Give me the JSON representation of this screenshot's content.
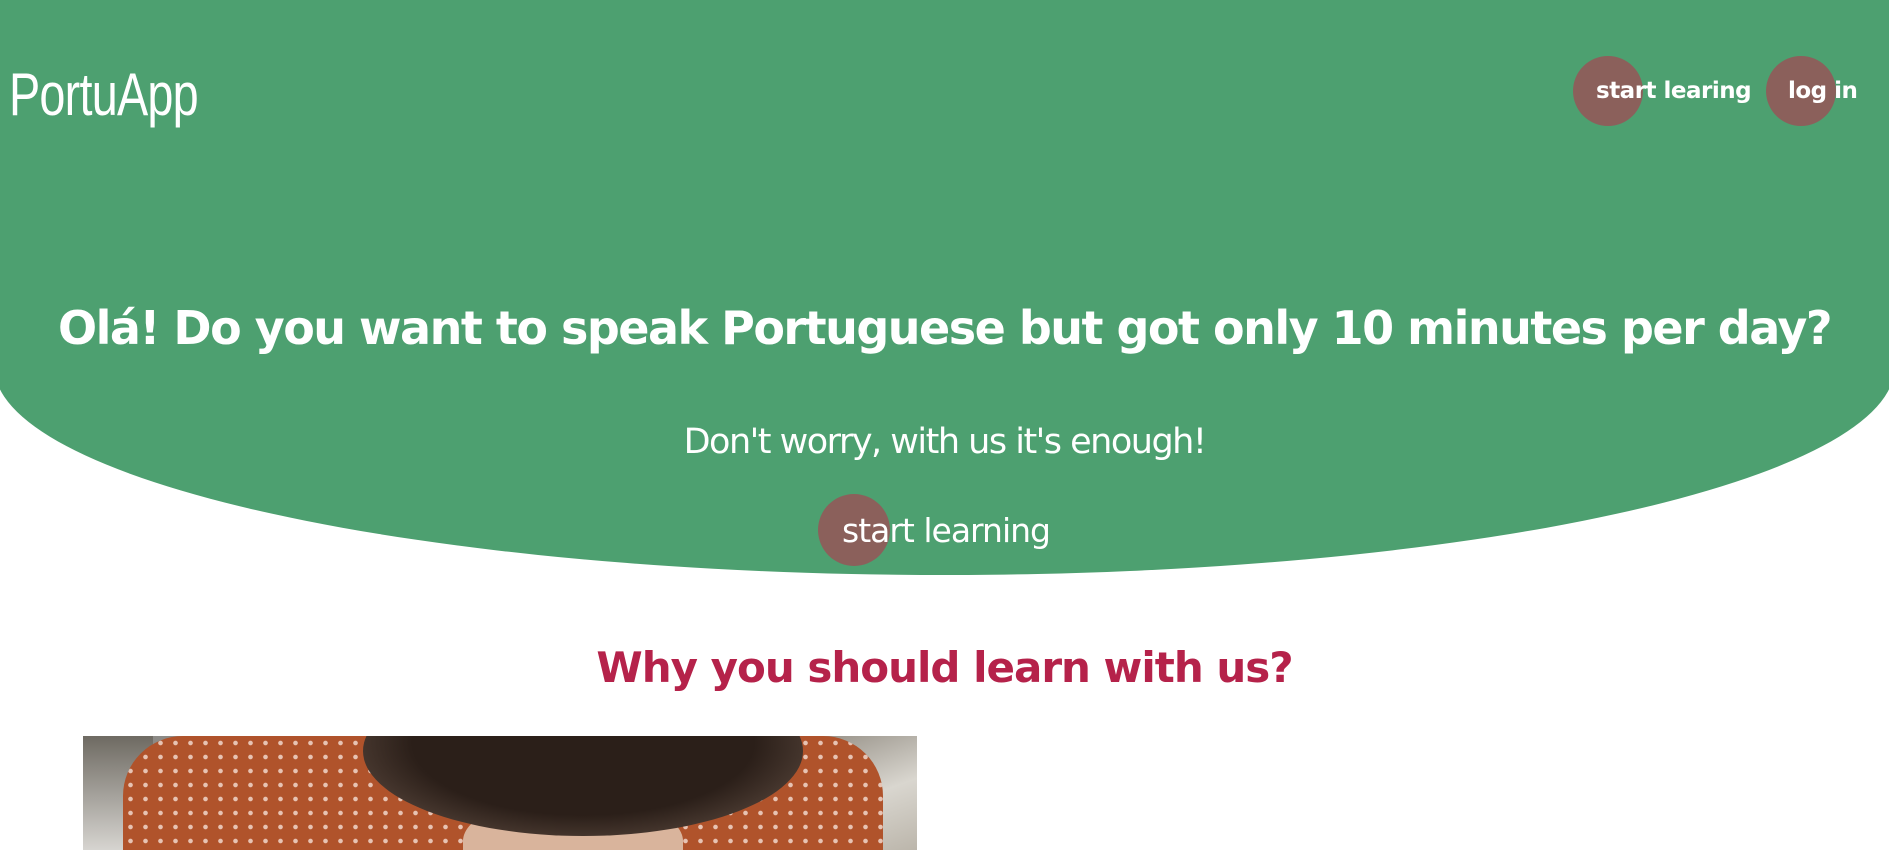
{
  "brand": {
    "logo": "PortuApp"
  },
  "nav": {
    "start_label": "start learing",
    "login_label": "log in"
  },
  "hero": {
    "title": "Olá! Do you want to speak Portuguese but got only 10 minutes per day?",
    "subtitle": "Don't worry, with us it's enough!",
    "cta_label": "start learning"
  },
  "why_section": {
    "heading": "Why you should learn with us?"
  },
  "colors": {
    "hero_green": "#4da070",
    "button_brown": "#8b605b",
    "heading_red": "#b5224a"
  }
}
